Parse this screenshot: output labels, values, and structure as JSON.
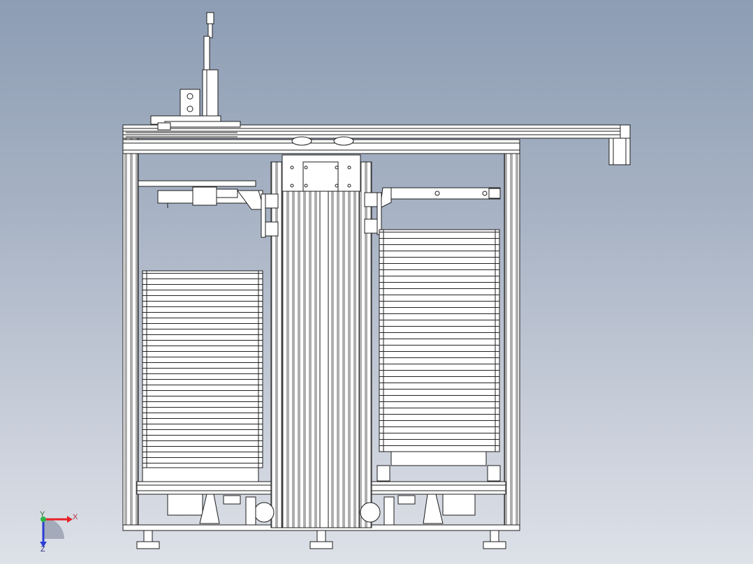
{
  "triad": {
    "x_label": "X",
    "y_label": "Y",
    "z_label": "Z",
    "x_color": "#e8222a",
    "y_color": "#33b54a",
    "z_color": "#2a3fd6"
  },
  "colors": {
    "line": "#1c1c1c",
    "part_fill": "#ffffff",
    "frame_fill": "#f6f6f6"
  }
}
